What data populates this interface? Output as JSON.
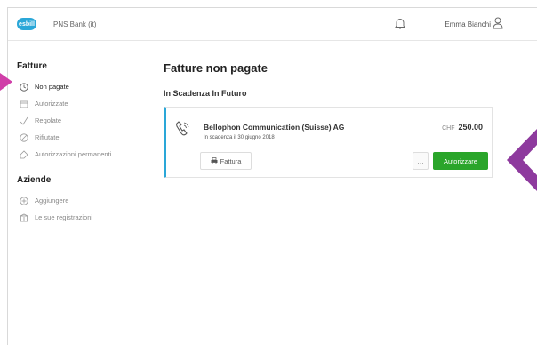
{
  "header": {
    "logo_text": "esbill",
    "bank_name": "PNS Bank (it)",
    "user_name": "Emma Bianchi"
  },
  "sidebar": {
    "section1_title": "Fatture",
    "fatture_items": [
      {
        "label": "Non pagate",
        "icon": "clock-icon",
        "active": true
      },
      {
        "label": "Autorizzate",
        "icon": "calendar-icon",
        "active": false
      },
      {
        "label": "Regolate",
        "icon": "check-icon",
        "active": false
      },
      {
        "label": "Rifiutate",
        "icon": "block-icon",
        "active": false
      },
      {
        "label": "Autorizzazioni permanenti",
        "icon": "tag-icon",
        "active": false
      }
    ],
    "section2_title": "Aziende",
    "aziende_items": [
      {
        "label": "Aggiungere",
        "icon": "plus-circle-icon"
      },
      {
        "label": "Le sue registrazioni",
        "icon": "building-icon"
      }
    ]
  },
  "main": {
    "page_title": "Fatture non pagate",
    "section_title": "In Scadenza In Futuro",
    "invoice": {
      "company": "Bellophon Communication (Suisse) AG",
      "due_text": "In scadenza il 30 giugno 2018",
      "currency": "CHF",
      "amount": "250.00",
      "fattura_label": "Fattura",
      "more_label": "…",
      "authorize_label": "Autorizzare"
    }
  },
  "colors": {
    "accent_blue": "#2aa7d8",
    "authorize_green": "#2aa52a",
    "annotation_magenta": "#d03ea8",
    "annotation_purple": "#8e3a9e"
  }
}
